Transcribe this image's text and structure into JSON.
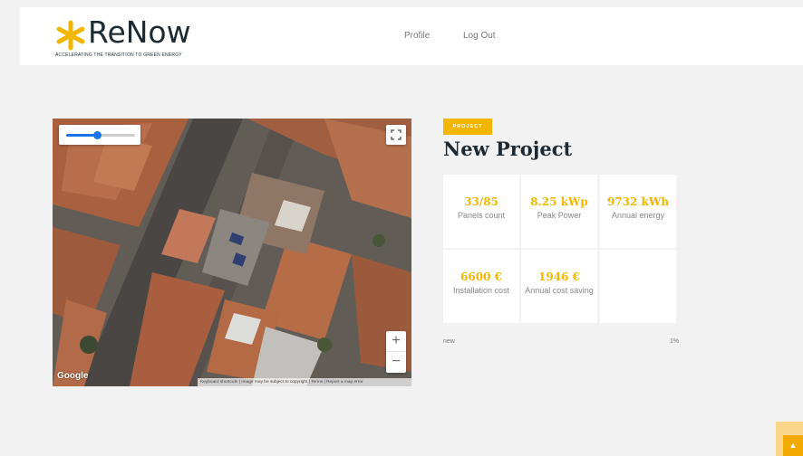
{
  "brand": {
    "name": "ReNow",
    "tagline": "ACCELERATING THE TRANSITION TO GREEN ENERGY",
    "accent_color": "#f2b600",
    "text_color": "#1d2a33"
  },
  "nav": {
    "profile": "Profile",
    "logout": "Log Out"
  },
  "map": {
    "provider_logo": "Google",
    "attribution": "Keyboard shortcuts | Image may be subject to copyright | Terms | Report a map error",
    "zoom_in": "+",
    "zoom_out": "−",
    "slider_level": 0.45
  },
  "project": {
    "badge": "PROJECT",
    "title": "New Project",
    "stats": [
      {
        "value": "33/85",
        "label": "Panels count"
      },
      {
        "value": "8.25 kWp",
        "label": "Peak Power"
      },
      {
        "value": "9732 kWh",
        "label": "Annual energy"
      },
      {
        "value": "6600 €",
        "label": "Installation cost"
      },
      {
        "value": "1946 €",
        "label": "Annual cost saving"
      }
    ],
    "status": "new",
    "progress": "1%"
  },
  "scroll_top_icon": "chevron-up-icon"
}
